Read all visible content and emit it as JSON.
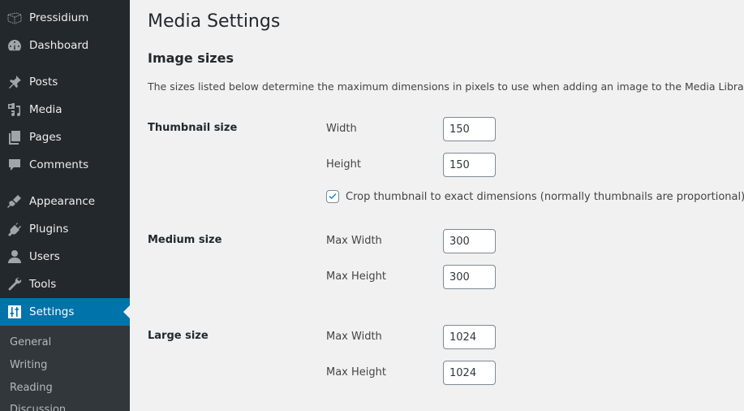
{
  "sidebar": {
    "site_name": "Pressidium",
    "items": [
      {
        "label": "Dashboard",
        "icon": "dashboard-icon"
      },
      {
        "label": "Posts",
        "icon": "pin-icon"
      },
      {
        "label": "Media",
        "icon": "media-icon"
      },
      {
        "label": "Pages",
        "icon": "pages-icon"
      },
      {
        "label": "Comments",
        "icon": "comment-icon"
      },
      {
        "label": "Appearance",
        "icon": "paintbrush-icon"
      },
      {
        "label": "Plugins",
        "icon": "plug-icon"
      },
      {
        "label": "Users",
        "icon": "user-icon"
      },
      {
        "label": "Tools",
        "icon": "wrench-icon"
      },
      {
        "label": "Settings",
        "icon": "sliders-icon",
        "active": true
      }
    ],
    "submenu": [
      "General",
      "Writing",
      "Reading",
      "Discussion"
    ]
  },
  "page": {
    "title": "Media Settings",
    "section_title": "Image sizes",
    "description": "The sizes listed below determine the maximum dimensions in pixels to use when adding an image to the Media Library."
  },
  "thumbnail": {
    "title": "Thumbnail size",
    "width_label": "Width",
    "width_value": "150",
    "height_label": "Height",
    "height_value": "150",
    "crop_label": "Crop thumbnail to exact dimensions (normally thumbnails are proportional)",
    "crop_checked": true
  },
  "medium": {
    "title": "Medium size",
    "width_label": "Max Width",
    "width_value": "300",
    "height_label": "Max Height",
    "height_value": "300"
  },
  "large": {
    "title": "Large size",
    "width_label": "Max Width",
    "width_value": "1024",
    "height_label": "Max Height",
    "height_value": "1024"
  },
  "colors": {
    "sidebar_bg": "#23282d",
    "submenu_bg": "#32373c",
    "accent": "#0073aa",
    "page_bg": "#f1f1f1"
  }
}
